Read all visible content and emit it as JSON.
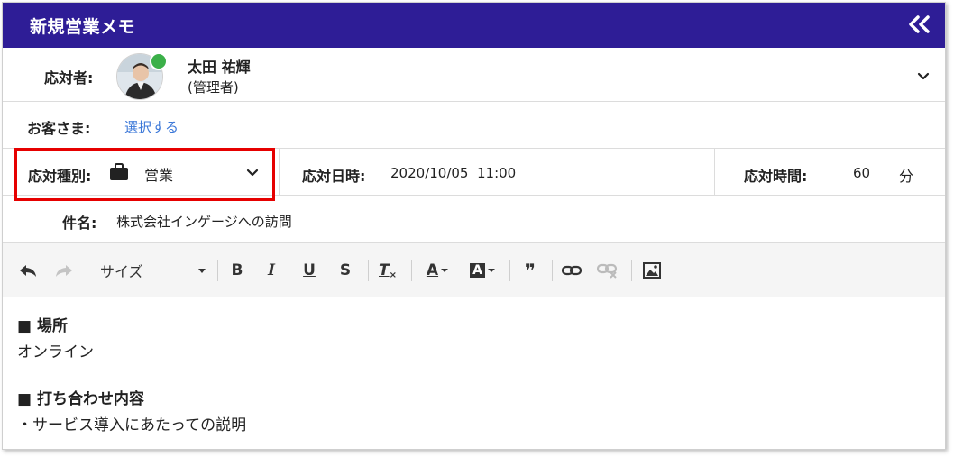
{
  "header": {
    "title": "新規営業メモ"
  },
  "responder": {
    "label": "応対者:",
    "name": "太田 祐輝",
    "role": "(管理者)"
  },
  "customer": {
    "label": "お客さま:",
    "link": "選択する"
  },
  "type": {
    "label": "応対種別:",
    "value": "営業"
  },
  "datetime": {
    "label": "応対日時:",
    "value": "2020/10/05  11:00"
  },
  "duration": {
    "label": "応対時間:",
    "value": "60",
    "unit": "分"
  },
  "subject": {
    "label": "件名:",
    "value": "株式会社インゲージへの訪問"
  },
  "toolbar": {
    "size_label": "サイズ",
    "bold": "B",
    "italic": "I",
    "underline": "U",
    "strike": "S",
    "clear": "T",
    "font_color": "A",
    "bg_color": "A",
    "quote": "❞"
  },
  "body": {
    "heading1": "■ 場所",
    "line1": "オンライン",
    "heading2": "■ 打ち合わせ内容",
    "line2": "・サービス導入にあたっての説明"
  },
  "colors": {
    "header_bg": "#2e1d96",
    "status_online": "#3bb049",
    "highlight": "#e60000",
    "link": "#3c78d8"
  }
}
